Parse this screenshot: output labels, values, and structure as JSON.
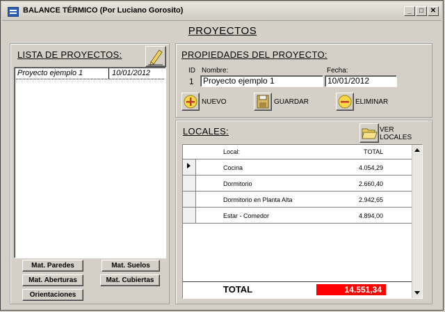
{
  "window": {
    "title": "BALANCE TÉRMICO (Por Luciano Gorosito)"
  },
  "page_title": "PROYECTOS",
  "left_panel": {
    "title": "LISTA DE PROYECTOS:",
    "projects": [
      {
        "name": "Proyecto ejemplo 1",
        "date": "10/01/2012"
      }
    ],
    "buttons": {
      "mat_paredes": "Mat. Paredes",
      "mat_suelos": "Mat. Suelos",
      "mat_aberturas": "Mat. Aberturas",
      "mat_cubiertas": "Mat. Cubiertas",
      "orientaciones": "Orientaciones"
    }
  },
  "props": {
    "title": "PROPIEDADES DEL PROYECTO:",
    "id_label": "ID",
    "id_value": "1",
    "name_label": "Nombre:",
    "name_value": "Proyecto ejemplo 1",
    "date_label": "Fecha:",
    "date_value": "10/01/2012",
    "btn_nuevo": "NUEVO",
    "btn_guardar": "GUARDAR",
    "btn_eliminar": "ELIMINAR"
  },
  "locales": {
    "title": "LOCALES:",
    "ver_line1": "VER",
    "ver_line2": "LOCALES",
    "col_local": "Local:",
    "col_total": "TOTAL",
    "rows": [
      {
        "local": "Cocina",
        "total": "4.054,29"
      },
      {
        "local": "Dormitorio",
        "total": "2.660,40"
      },
      {
        "local": "Dormitorio en Planta Alta",
        "total": "2.942,65"
      },
      {
        "local": "Estar - Comedor",
        "total": "4.894,00"
      }
    ],
    "total_label": "TOTAL",
    "total_value": "14.551,34",
    "total_color": "#ff0000"
  }
}
